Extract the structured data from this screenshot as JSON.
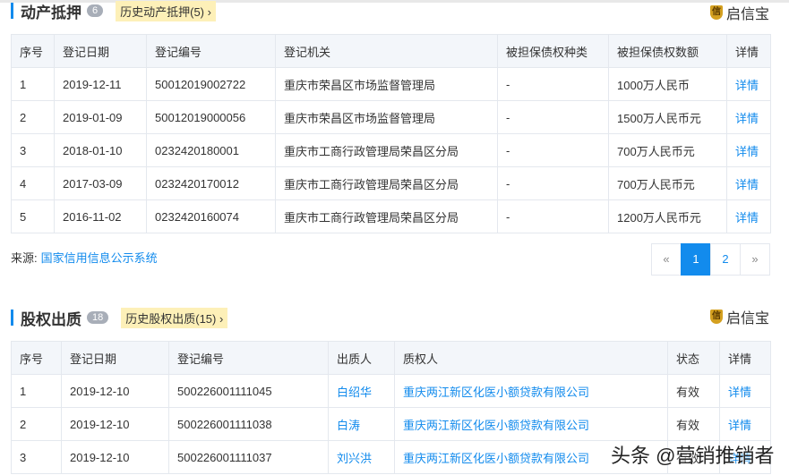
{
  "section1": {
    "title": "动产抵押",
    "count": "6",
    "history": "历史动产抵押(5) ›",
    "logo": "启信宝",
    "headers": [
      "序号",
      "登记日期",
      "登记编号",
      "登记机关",
      "被担保债权种类",
      "被担保债权数额",
      "详情"
    ],
    "rows": [
      [
        "1",
        "2019-12-11",
        "50012019002722",
        "重庆市荣昌区市场监督管理局",
        "-",
        "1000万人民币",
        "详情"
      ],
      [
        "2",
        "2019-01-09",
        "50012019000056",
        "重庆市荣昌区市场监督管理局",
        "-",
        "1500万人民币元",
        "详情"
      ],
      [
        "3",
        "2018-01-10",
        "0232420180001",
        "重庆市工商行政管理局荣昌区分局",
        "-",
        "700万人民币元",
        "详情"
      ],
      [
        "4",
        "2017-03-09",
        "0232420170012",
        "重庆市工商行政管理局荣昌区分局",
        "-",
        "700万人民币元",
        "详情"
      ],
      [
        "5",
        "2016-11-02",
        "0232420160074",
        "重庆市工商行政管理局荣昌区分局",
        "-",
        "1200万人民币元",
        "详情"
      ]
    ],
    "source_label": "来源:",
    "source_link": "国家信用信息公示系统",
    "pager": [
      "«",
      "1",
      "2",
      "»"
    ]
  },
  "section2": {
    "title": "股权出质",
    "count": "18",
    "history": "历史股权出质(15) ›",
    "logo": "启信宝",
    "headers": [
      "序号",
      "登记日期",
      "登记编号",
      "出质人",
      "质权人",
      "状态",
      "详情"
    ],
    "rows": [
      [
        "1",
        "2019-12-10",
        "500226001111045",
        "白绍华",
        "重庆两江新区化医小额贷款有限公司",
        "有效",
        "详情"
      ],
      [
        "2",
        "2019-12-10",
        "500226001111038",
        "白涛",
        "重庆两江新区化医小额贷款有限公司",
        "有效",
        "详情"
      ],
      [
        "3",
        "2019-12-10",
        "500226001111037",
        "刘兴洪",
        "重庆两江新区化医小额贷款有限公司",
        "有效",
        "详情"
      ]
    ]
  },
  "watermark": "头条 @营销推销者"
}
